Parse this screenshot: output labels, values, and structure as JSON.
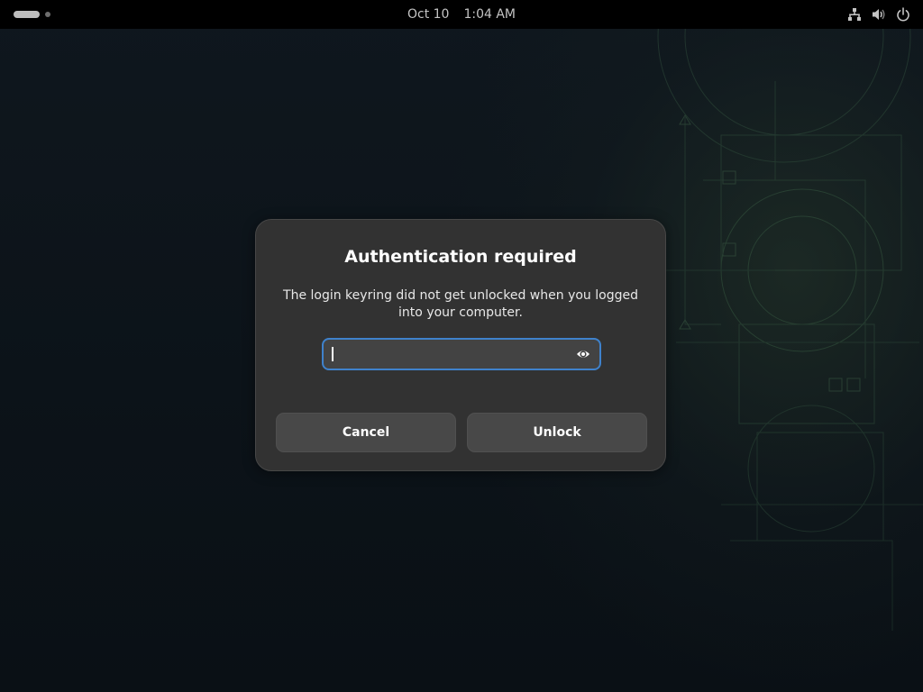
{
  "top_bar": {
    "date": "Oct 10",
    "time": "1:04 AM",
    "tray_icons": [
      "network-wired-icon",
      "volume-icon",
      "power-icon"
    ]
  },
  "dialog": {
    "title": "Authentication required",
    "message": "The login keyring did not get unlocked when you logged into your computer.",
    "password": {
      "value": "",
      "placeholder": "",
      "type": "password",
      "reveal_icon": "eye-icon"
    },
    "buttons": {
      "cancel_label": "Cancel",
      "unlock_label": "Unlock"
    }
  },
  "colors": {
    "top_bar": "#000000",
    "dialog_bg": "#323232",
    "button_bg": "#484848",
    "focus_ring": "#3f82cc",
    "entry_bg": "#434343"
  }
}
